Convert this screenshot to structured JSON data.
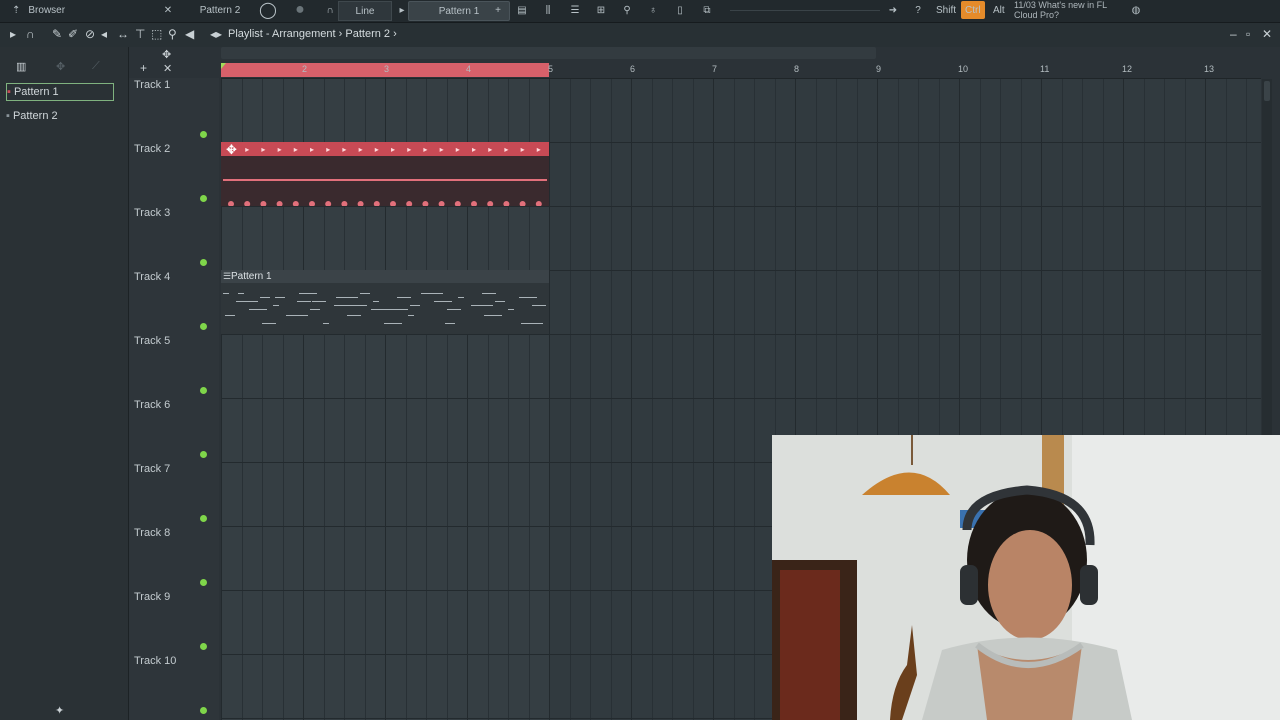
{
  "topbar": {
    "browser_label": "Browser",
    "pattern_tab_label": "Pattern 2",
    "snap_value": "Line",
    "current_pattern": "Pattern 1",
    "shift_key": "Shift",
    "ctrl_key": "Ctrl",
    "alt_key": "Alt",
    "hint_line1": "11/03  What's new in FL",
    "hint_line2": "Cloud Pro?"
  },
  "playlist": {
    "window_title": "Playlist - Arrangement",
    "active_pattern": "Pattern 2",
    "breadcrumb_sep": "›"
  },
  "picker": {
    "patterns": [
      "Pattern 1",
      "Pattern 2"
    ]
  },
  "tracks": [
    "Track 1",
    "Track 2",
    "Track 3",
    "Track 4",
    "Track 5",
    "Track 6",
    "Track 7",
    "Track 8",
    "Track 9",
    "Track 10"
  ],
  "ruler": {
    "bars": [
      "2",
      "3",
      "4",
      "5",
      "6",
      "7",
      "8",
      "9",
      "10",
      "11",
      "12",
      "13"
    ]
  },
  "clips": {
    "pattern1_label": "Pattern 1"
  },
  "colors": {
    "accent_red": "#c84a55",
    "loop_range": "#d7606a",
    "track_dot": "#7fd64a",
    "ctrl_orange": "#e58b2a"
  }
}
